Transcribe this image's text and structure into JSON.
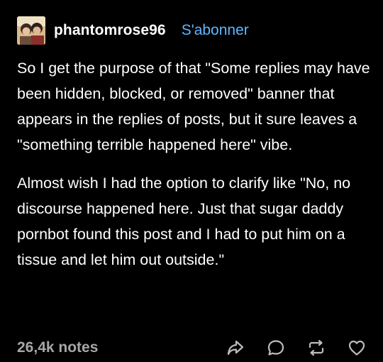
{
  "post": {
    "username": "phantomrose96",
    "follow_label": "S'abonner",
    "paragraphs": [
      "So I get the purpose of that \"Some replies may have been hidden, blocked, or removed\" banner that appears in the replies of posts, but it sure leaves a \"something terrible happened here\" vibe.",
      "Almost wish I had the option to clarify like \"No, no discourse happened here. Just that sugar daddy pornbot found this post and I had to put him on a tissue and let him out outside.\""
    ],
    "notes": "26,4k notes"
  },
  "actions": {
    "share_icon": "share-arrow-icon",
    "reply_icon": "comment-bubble-icon",
    "reblog_icon": "reblog-icon",
    "like_icon": "heart-icon"
  },
  "colors": {
    "background": "#000000",
    "text": "#ffffff",
    "follow": "#5fb6ff",
    "muted": "#a7a7a7"
  }
}
